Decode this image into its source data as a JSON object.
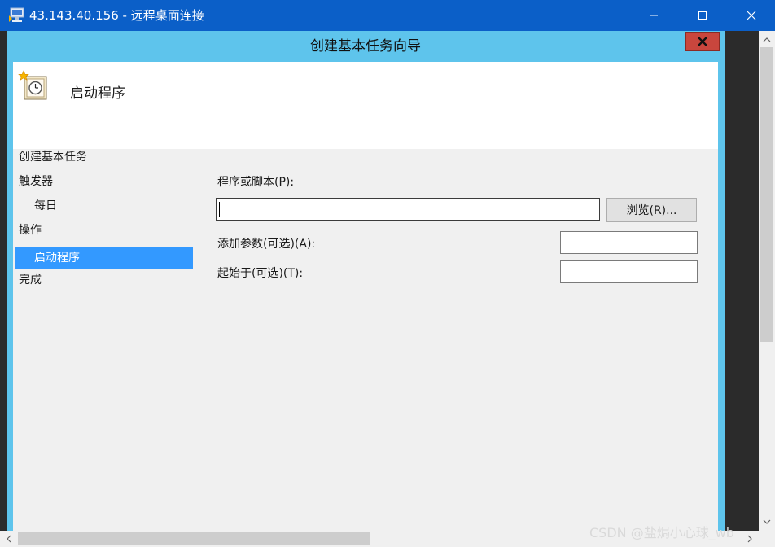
{
  "window": {
    "title": "43.143.40.156 - 远程桌面连接",
    "icon": "remote-desktop-icon"
  },
  "dialog": {
    "title": "创建基本任务向导",
    "close_label": "X",
    "header_title": "启动程序",
    "header_icon": "scheduled-task-clock-icon"
  },
  "nav": {
    "items": [
      {
        "label": "创建基本任务",
        "selected": false
      },
      {
        "label": "触发器",
        "selected": false
      },
      {
        "label": "每日",
        "selected": false
      },
      {
        "label": "操作",
        "selected": false
      },
      {
        "label": "启动程序",
        "selected": true
      },
      {
        "label": "完成",
        "selected": false
      }
    ]
  },
  "form": {
    "program_label": "程序或脚本(P):",
    "program_value": "",
    "browse_label": "浏览(R)...",
    "args_label": "添加参数(可选)(A):",
    "args_value": "",
    "start_in_label": "起始于(可选)(T):",
    "start_in_value": ""
  },
  "watermark": "CSDN @盐焗小心球_wb",
  "colors": {
    "titlebar": "#0b5fc8",
    "dialog_frame": "#5ec4ec",
    "selected_nav": "#3399ff",
    "dialog_close": "#c9463d"
  }
}
